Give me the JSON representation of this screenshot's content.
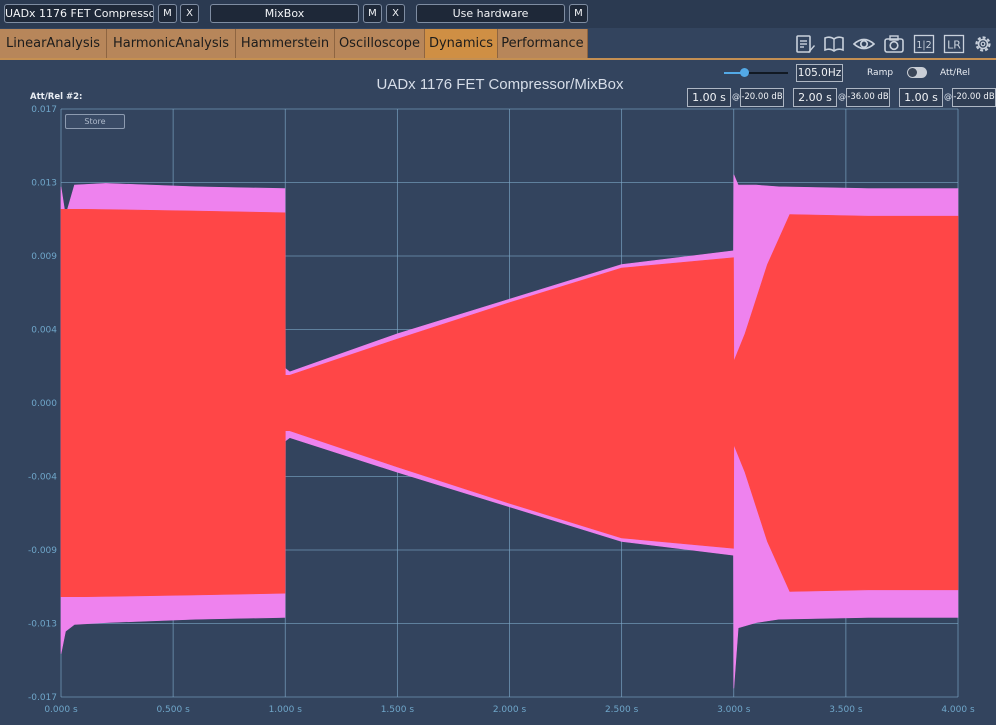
{
  "toolbar": {
    "device_label": "UADx 1176 FET Compressor",
    "device_m": "M",
    "device_x": "X",
    "mixbox_label": "MixBox",
    "mixbox_m": "M",
    "mixbox_x": "X",
    "hardware_label": "Use hardware",
    "hardware_m": "M"
  },
  "tabs": [
    {
      "label": "LinearAnalysis"
    },
    {
      "label": "HarmonicAnalysis"
    },
    {
      "label": "Hammerstein"
    },
    {
      "label": "Oscilloscope"
    },
    {
      "label": "Dynamics",
      "active": true
    },
    {
      "label": "Performance"
    }
  ],
  "icons": [
    "notes-icon",
    "book-icon",
    "eye-icon",
    "camera-icon",
    "split-1-2-icon",
    "lr-icon",
    "gear-icon"
  ],
  "icon_text": {
    "split": "1|2",
    "lr": "LR"
  },
  "header": {
    "title": "UADx 1176 FET Compressor/MixBox",
    "att_rel_label": "Att/Rel #2:",
    "frequency": "105.0Hz",
    "ramp_label": "Ramp",
    "att_rel_toggle_label": "Att/Rel",
    "store_label": "Store",
    "at": "@",
    "segments": [
      {
        "time": "1.00 s",
        "level": "-20.00 dB"
      },
      {
        "time": "2.00 s",
        "level": "-36.00 dB"
      },
      {
        "time": "1.00 s",
        "level": "-20.00 dB"
      }
    ]
  },
  "colors": {
    "background": "#33445e",
    "grid": "#7ea9c9",
    "waveform_main": "#ff4647",
    "waveform_envelope": "#ee82ee",
    "tab": "#b7865a",
    "tab_active": "#cf8f44"
  },
  "chart_data": {
    "type": "area",
    "title": "UADx 1176 FET Compressor/MixBox",
    "xlabel": "",
    "ylabel": "",
    "x_ticks": [
      "0.000 s",
      "0.500 s",
      "1.000 s",
      "1.500 s",
      "2.000 s",
      "2.500 s",
      "3.000 s",
      "3.500 s",
      "4.000 s"
    ],
    "y_ticks": [
      "0.017",
      "0.013",
      "0.009",
      "0.004",
      "0.000",
      "-0.004",
      "-0.009",
      "-0.013",
      "-0.017"
    ],
    "xlim": [
      0,
      4
    ],
    "ylim": [
      -0.017,
      0.017
    ],
    "grid": true,
    "series": [
      {
        "color": "#ee82ee",
        "x": [
          0.0,
          0.02,
          0.06,
          0.2,
          0.6,
          0.999,
          1.0,
          1.02,
          1.5,
          2.0,
          2.5,
          2.999,
          3.0,
          3.02,
          3.1,
          3.2,
          3.6,
          4.0
        ],
        "upper": [
          0.0125,
          0.0108,
          0.0126,
          0.0127,
          0.0125,
          0.0124,
          0.002,
          0.0018,
          0.004,
          0.006,
          0.008,
          0.0088,
          0.0132,
          0.0126,
          0.0126,
          0.0125,
          0.0124,
          0.0124
        ],
        "lower": [
          -0.0145,
          -0.0132,
          -0.0128,
          -0.0127,
          -0.0125,
          -0.0124,
          -0.0022,
          -0.002,
          -0.004,
          -0.006,
          -0.008,
          -0.0088,
          -0.0165,
          -0.013,
          -0.0127,
          -0.0125,
          -0.0124,
          -0.0124
        ]
      },
      {
        "color": "#ff4647",
        "x": [
          0.0,
          0.1,
          0.6,
          0.999,
          1.0,
          1.02,
          1.5,
          2.0,
          2.5,
          2.999,
          3.0,
          3.05,
          3.15,
          3.25,
          3.6,
          4.0
        ],
        "upper": [
          0.0112,
          0.0112,
          0.0111,
          0.011,
          0.0016,
          0.0016,
          0.0037,
          0.0058,
          0.0078,
          0.0084,
          0.0024,
          0.004,
          0.008,
          0.0109,
          0.0108,
          0.0108
        ],
        "lower": [
          -0.0112,
          -0.0112,
          -0.0111,
          -0.011,
          -0.0016,
          -0.0016,
          -0.0037,
          -0.0058,
          -0.0078,
          -0.0084,
          -0.0024,
          -0.004,
          -0.008,
          -0.0109,
          -0.0108,
          -0.0108
        ]
      }
    ]
  }
}
